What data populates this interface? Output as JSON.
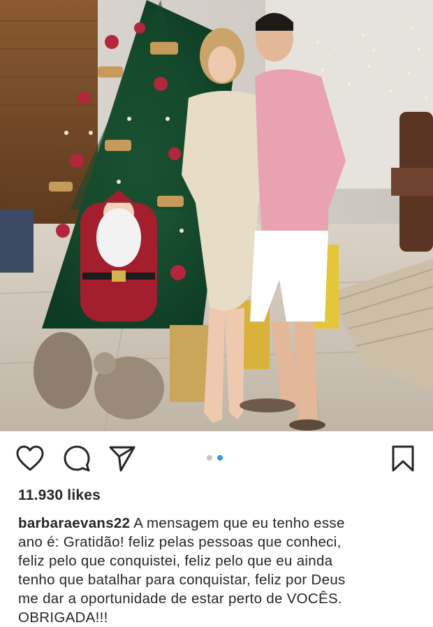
{
  "post": {
    "photo": {
      "scene": "couple-in-front-of-christmas-tree"
    },
    "actions": {
      "like_icon": "heart-outline-icon",
      "comment_icon": "speech-bubble-icon",
      "share_icon": "paper-plane-icon",
      "save_icon": "bookmark-outline-icon"
    },
    "carousel": {
      "count": 2,
      "active_index": 2
    },
    "likes_text": "11.930 likes",
    "caption": {
      "username": "barbaraevans22",
      "line1": "A mensagem que eu tenho esse",
      "line2": "ano é: Gratidão! feliz pelas pessoas que conheci,",
      "line3": "feliz pelo que conquistei, feliz pelo que eu ainda",
      "line4": "tenho que batalhar para conquistar, feliz por Deus",
      "line5": "me dar a oportunidade de estar perto de VOCÊS.",
      "line6": "OBRIGADA!!!"
    },
    "colors": {
      "dot_active": "#3897f0",
      "dot_inactive": "#c7c7c7",
      "text": "#262626"
    }
  }
}
